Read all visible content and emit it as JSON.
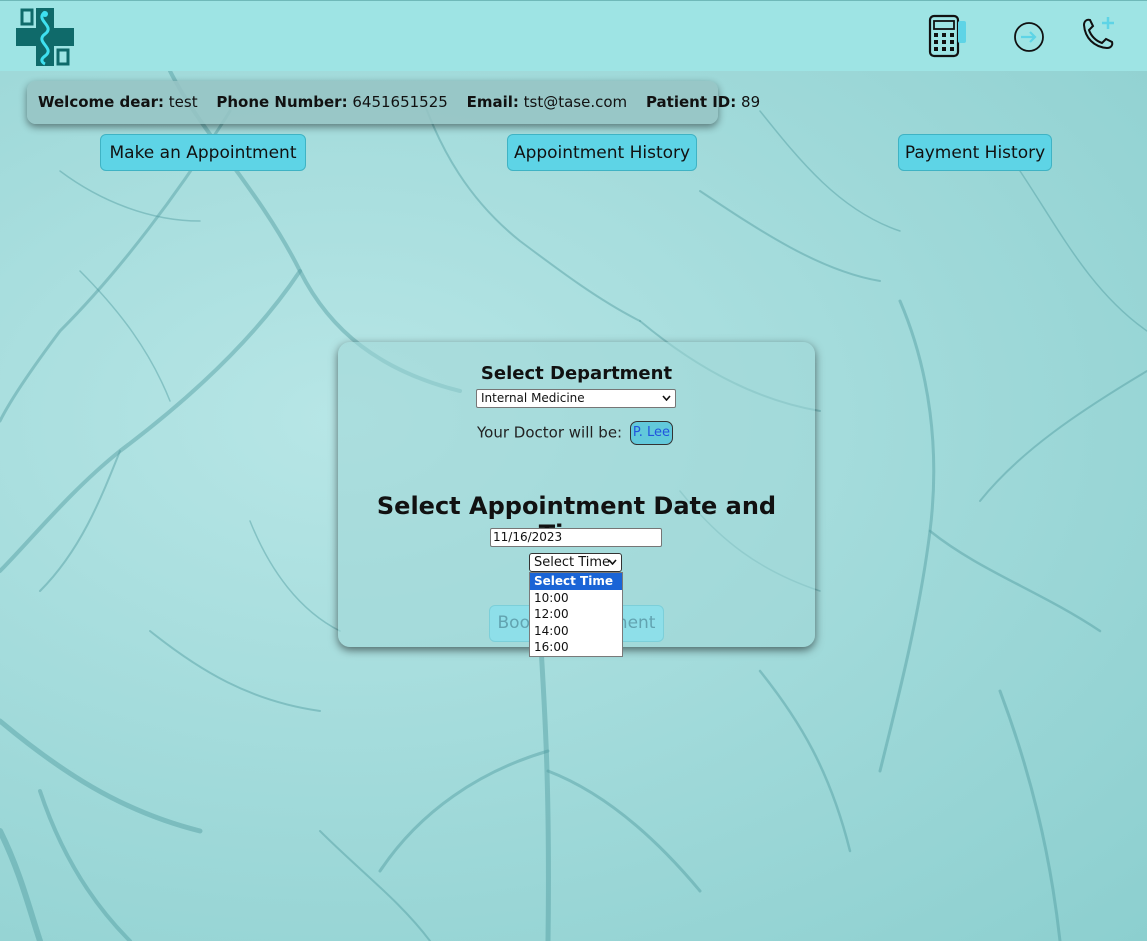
{
  "header": {
    "logo_icon": "caduceus-cross-logo",
    "icons": [
      "calculator-icon",
      "logout-arrow-icon",
      "phone-plus-icon"
    ]
  },
  "patient_info": {
    "welcome_label": "Welcome dear:",
    "welcome_value": "test",
    "phone_label": "Phone Number:",
    "phone_value": "6451651525",
    "email_label": "Email:",
    "email_value": "tst@tase.com",
    "patient_id_label": "Patient ID:",
    "patient_id_value": "89"
  },
  "nav": {
    "make_appointment": "Make an Appointment",
    "appointment_history": "Appointment History",
    "payment_history": "Payment History"
  },
  "appointment_form": {
    "department_title": "Select Department",
    "department_selected": "Internal Medicine",
    "doctor_prefix": "Your Doctor will be:",
    "doctor_name": "P. Lee",
    "datetime_title": "Select Appointment Date and Time:",
    "date_value": "11/16/2023",
    "time_selected": "Select Time",
    "time_options": [
      "Select Time",
      "10:00",
      "12:00",
      "14:00",
      "16:00"
    ],
    "book_button": "Book Appointment"
  },
  "colors": {
    "header_bg": "#9ee4e4",
    "button_bg": "#5ed4e6",
    "logo_teal": "#0f6a6a",
    "dropdown_highlight": "#1a64d6"
  }
}
